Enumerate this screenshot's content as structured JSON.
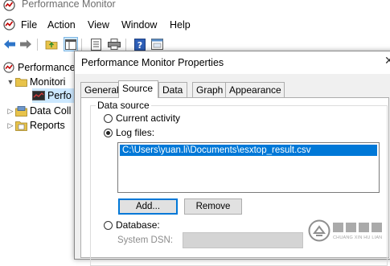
{
  "window": {
    "title": "Performance Monitor"
  },
  "menu": [
    "File",
    "Action",
    "View",
    "Window",
    "Help"
  ],
  "tree": [
    {
      "label": "Performance"
    },
    {
      "label": "Monitori"
    },
    {
      "label": "Perfo"
    },
    {
      "label": "Data Coll"
    },
    {
      "label": "Reports"
    }
  ],
  "dialog": {
    "title": "Performance Monitor Properties",
    "tabs": [
      "General",
      "Source",
      "Data",
      "Graph",
      "Appearance"
    ],
    "active_tab": "Source",
    "group_label": "Data source",
    "options": {
      "current_activity": "Current activity",
      "log_files": "Log files:",
      "database": "Database:"
    },
    "selected_option": "log_files",
    "log_file_path": "C:\\Users\\yuan.li\\Documents\\esxtop_result.csv",
    "add_button": "Add...",
    "remove_button": "Remove",
    "system_dsn_label": "System DSN:"
  },
  "watermark": {
    "text": "创新互联",
    "subtext": "CHUANG XIN HU LIAN"
  }
}
